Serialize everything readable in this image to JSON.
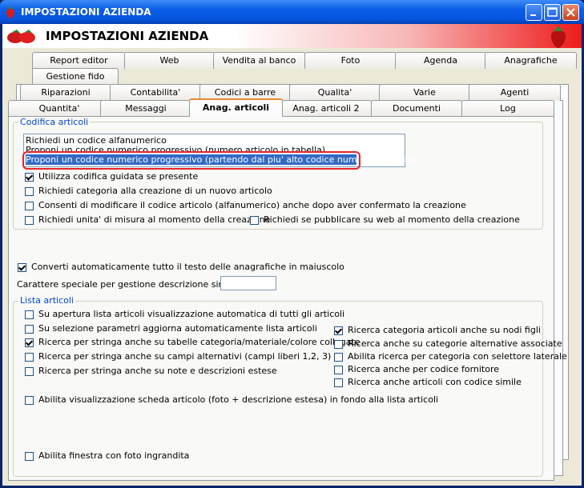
{
  "window": {
    "title": "IMPOSTAZIONI AZIENDA",
    "header_title": "IMPOSTAZIONI AZIENDA"
  },
  "tabs_row1": [
    "Report editor",
    "Web",
    "Vendita al banco",
    "Foto",
    "Agenda",
    "Anagrafiche"
  ],
  "tabs_row1b": [
    "Gestione fido"
  ],
  "tabs_row2": [
    "Riparazioni",
    "Contabilita'",
    "Codici a barre",
    "Qualita'",
    "Varie",
    "Agenti"
  ],
  "tabs_row3": [
    "Quantita'",
    "Messaggi",
    "Anag. articoli",
    "Anag. articoli 2",
    "Documenti",
    "Log"
  ],
  "codifica": {
    "label": "Codifica articoli",
    "options": [
      "Richiedi un codice alfanumerico",
      "Proponi un codice numerico progressivo (numero articolo in tabella)",
      "Proponi un codice numerico progressivo (partendo dal piu' alto codice numerico inserito)"
    ],
    "checks": [
      {
        "label": "Utilizza codifica guidata se presente",
        "checked": true
      },
      {
        "label": "Richiedi categoria alla creazione di un nuovo articolo",
        "checked": false
      },
      {
        "label": "Consenti di modificare il codice articolo (alfanumerico) anche dopo aver confermato la creazione",
        "checked": false
      },
      {
        "label": "Richiedi unita' di misura al momento della creazione",
        "checked": false
      },
      {
        "label": "Richiedi se pubblicare su web al momento della creazione",
        "checked": false
      }
    ]
  },
  "converti": {
    "label": "Converti automaticamente tutto il testo delle anagrafiche in maiuscolo",
    "checked": true
  },
  "carattere_label": "Carattere speciale per gestione descrizione sintetica :",
  "carattere_value": "",
  "lista": {
    "label": "Lista articoli",
    "left": [
      {
        "label": "Su apertura lista articoli visualizzazione automatica di tutti gli articoli",
        "checked": false
      },
      {
        "label": "Su selezione parametri aggiorna automaticamente lista articoli",
        "checked": false
      },
      {
        "label": "Ricerca per stringa anche su tabelle categoria/materiale/colore collegate",
        "checked": true
      },
      {
        "label": "Ricerca per stringa anche su campi alternativi (campi liberi 1,2, 3)",
        "checked": false
      },
      {
        "label": "Ricerca per stringa anche su note e descrizioni estese",
        "checked": false
      }
    ],
    "right": [
      {
        "label": "Ricerca categoria articoli anche su nodi figli",
        "checked": true
      },
      {
        "label": "Ricerca anche su categorie alternative associate",
        "checked": false
      },
      {
        "label": "Abilita ricerca per categoria con selettore laterale",
        "checked": false
      },
      {
        "label": "Ricerca anche per codice fornitore",
        "checked": false
      },
      {
        "label": "Ricerca anche articoli con codice simile",
        "checked": false
      }
    ],
    "scheda": {
      "label": "Abilita visualizzazione scheda articolo (foto + descrizione estesa) in fondo alla lista articoli",
      "checked": false
    },
    "foto": {
      "label": "Abilita finestra con foto ingrandita",
      "checked": false
    }
  }
}
